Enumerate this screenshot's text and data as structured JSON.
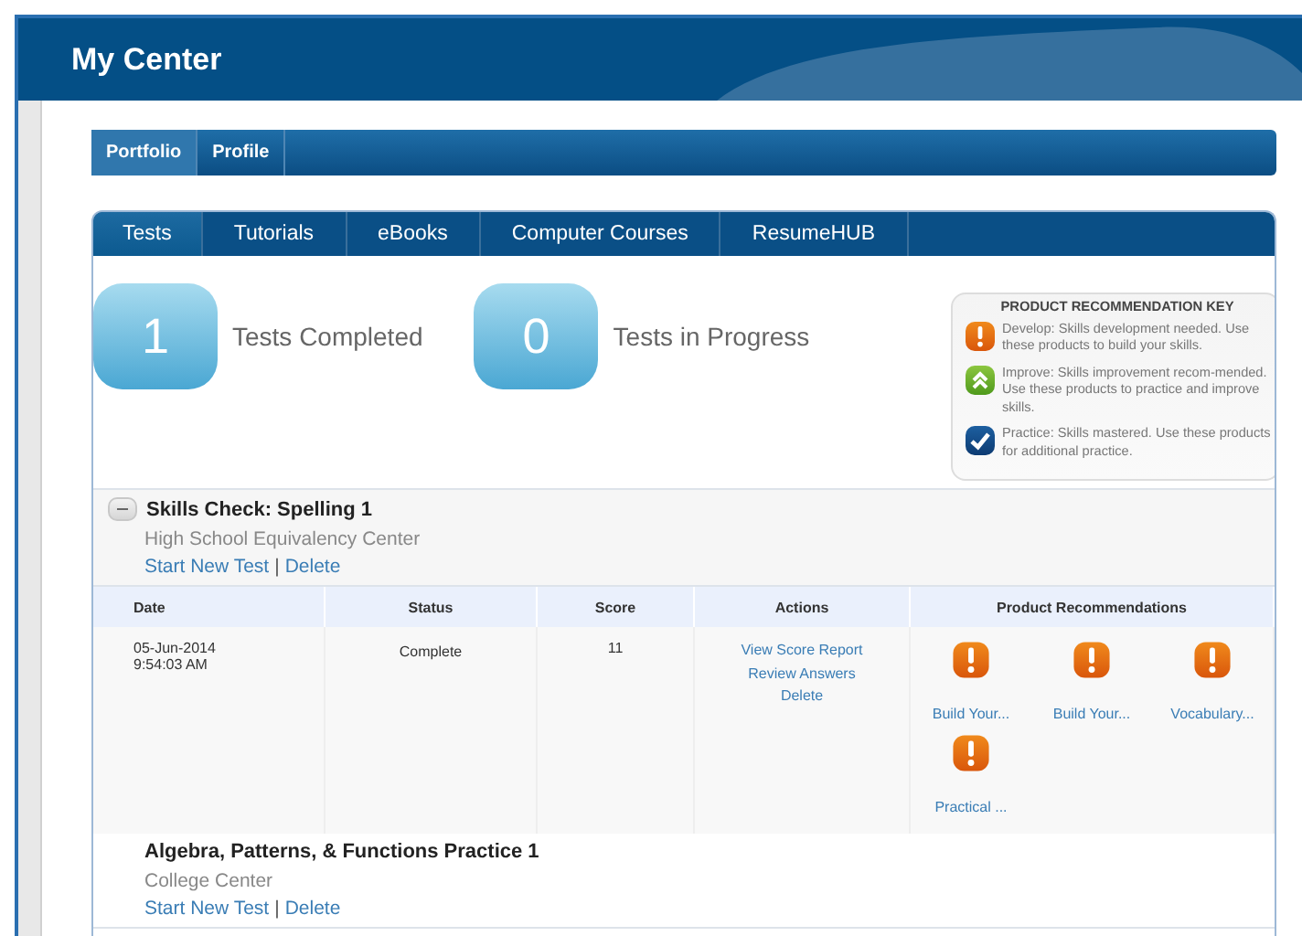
{
  "header": {
    "title": "My Center"
  },
  "nav": [
    {
      "label": "Portfolio",
      "selected": true
    },
    {
      "label": "Profile",
      "selected": false
    }
  ],
  "tabs": [
    {
      "label": "Tests",
      "selected": true
    },
    {
      "label": "Tutorials",
      "selected": false
    },
    {
      "label": "eBooks",
      "selected": false
    },
    {
      "label": "Computer Courses",
      "selected": false
    },
    {
      "label": "ResumeHUB",
      "selected": false
    }
  ],
  "stats": [
    {
      "count": "1",
      "label": "Tests Completed"
    },
    {
      "count": "0",
      "label": "Tests in Progress"
    }
  ],
  "key": {
    "title": "PRODUCT RECOMMENDATION KEY",
    "items": [
      {
        "kind": "develop",
        "text": "Develop: Skills development needed. Use these products to build your skills."
      },
      {
        "kind": "improve",
        "text": "Improve: Skills improvement recom-mended. Use these products to practice and improve skills."
      },
      {
        "kind": "practice",
        "text": "Practice: Skills mastered. Use these products for additional practice."
      }
    ]
  },
  "tests": [
    {
      "title": "Skills Check: Spelling 1",
      "expanded": true,
      "center": "High School Equivalency Center",
      "links": [
        "Start New Test",
        "Delete"
      ],
      "link_separator": "|",
      "table": {
        "columns": [
          "Date",
          "Status",
          "Score",
          "Actions",
          "Product Recommendations"
        ],
        "rows": [
          {
            "date": [
              "05-Jun-2014",
              "9:54:03 AM"
            ],
            "status": "Complete",
            "score": "11",
            "actions": [
              "View Score Report",
              "Review Answers",
              "Delete"
            ],
            "products": [
              {
                "kind": "develop",
                "label": "Build Your..."
              },
              {
                "kind": "develop",
                "label": "Build Your..."
              },
              {
                "kind": "develop",
                "label": "Vocabulary..."
              },
              {
                "kind": "develop",
                "label": "Practical ..."
              }
            ]
          }
        ]
      }
    },
    {
      "title": "Algebra, Patterns, & Functions Practice 1",
      "center": "College Center",
      "links": [
        "Start New Test",
        "Delete"
      ],
      "link_separator": "|"
    }
  ]
}
